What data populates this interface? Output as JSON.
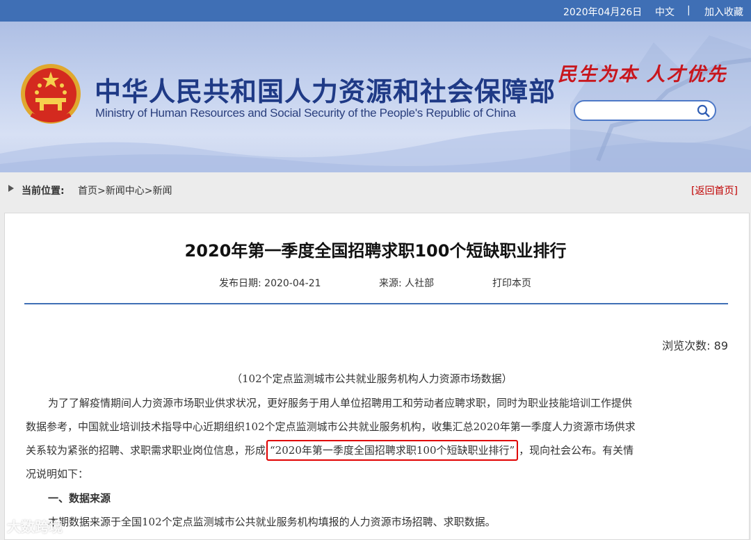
{
  "topbar": {
    "date": "2020年04月26日",
    "lang": "中文",
    "separator": "|",
    "favorite": "加入收藏"
  },
  "banner": {
    "title_cn": "中华人民共和国人力资源和社会保障部",
    "title_en": "Ministry of Human Resources and Social Security of the People's Republic of China",
    "slogan": "民生为本 人才优先",
    "search_placeholder": ""
  },
  "breadcrumb": {
    "label": "当前位置:",
    "path": "首页>新闻中心>新闻",
    "back": "[返回首页]"
  },
  "article": {
    "title": "2020年第一季度全国招聘求职100个短缺职业排行",
    "publish_date": "发布日期:  2020-04-21",
    "source": "来源:  人社部",
    "print": "打印本页",
    "views": "浏览次数:  89",
    "subtitle": "（102个定点监测城市公共就业服务机构人力资源市场数据）",
    "line1": "为了了解疫情期间人力资源市场职业供求状况，更好服务于用人单位招聘用工和劳动者应聘求职，同时为职业技能培训工作提供",
    "line2": "数据参考，中国就业培训技术指导中心近期组织102个定点监测城市公共就业服务机构，收集汇总2020年第一季度人力资源市场供求",
    "line3_pre": "关系较为紧张的招聘、求职需求职业岗位信息，形成",
    "line3_hl": "“2020年第一季度全国招聘求职100个短缺职业排行”",
    "line3_post": "，现向社会公布。有关情",
    "line4": "况说明如下：",
    "section1": "一、数据来源",
    "line5": "本期数据来源于全国102个定点监测城市公共就业服务机构填报的人力资源市场招聘、求职数据。"
  },
  "watermark": "大数跨境",
  "colors": {
    "topbar": "#3f6fb5",
    "title_cn": "#1f3a86",
    "slogan": "#c8161d",
    "highlight_border": "#e00000",
    "rule": "#3f6fb5"
  }
}
